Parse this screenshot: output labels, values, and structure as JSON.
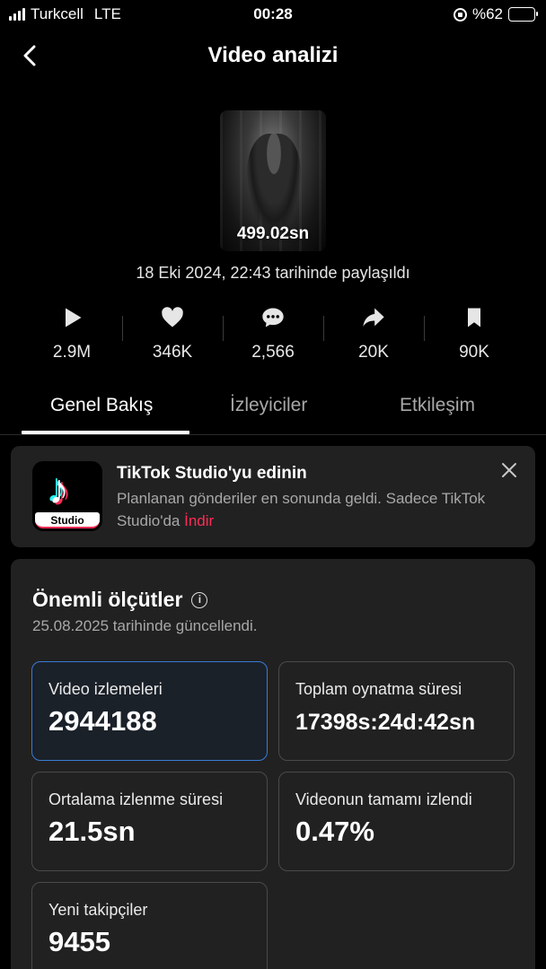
{
  "status_bar": {
    "carrier": "Turkcell",
    "network": "LTE",
    "time": "00:28",
    "battery_text": "%62",
    "battery_level": 0.62,
    "icons": [
      "signal-icon",
      "orientation-lock-icon",
      "battery-charging-icon"
    ]
  },
  "header": {
    "title": "Video analizi",
    "back_icon": "chevron-left-icon"
  },
  "video": {
    "duration": "499.02sn",
    "posted": "18 Eki 2024, 22:43 tarihinde paylaşıldı"
  },
  "stats": [
    {
      "icon": "play-icon",
      "value": "2.9M"
    },
    {
      "icon": "heart-icon",
      "value": "346K"
    },
    {
      "icon": "comment-icon",
      "value": "2,566"
    },
    {
      "icon": "share-icon",
      "value": "20K"
    },
    {
      "icon": "bookmark-icon",
      "value": "90K"
    }
  ],
  "tabs": [
    {
      "label": "Genel Bakış",
      "active": true
    },
    {
      "label": "İzleyiciler",
      "active": false
    },
    {
      "label": "Etkileşim",
      "active": false
    }
  ],
  "promo": {
    "logo_text": "Studio",
    "title": "TikTok Studio'yu edinin",
    "text": "Planlanan gönderiler en sonunda geldi. Sadece TikTok Studio'da",
    "link": "İndir",
    "close_icon": "close-icon"
  },
  "metrics": {
    "title": "Önemli ölçütler",
    "info_icon": "info-icon",
    "updated": "25.08.2025 tarihinde güncellendi.",
    "tiles": [
      {
        "label": "Video izlemeleri",
        "value": "2944188",
        "selected": true
      },
      {
        "label": "Toplam oynatma süresi",
        "value": "17398s:24d:42sn",
        "selected": false
      },
      {
        "label": "Ortalama izlenme süresi",
        "value": "21.5sn",
        "selected": false
      },
      {
        "label": "Videonun tamamı izlendi",
        "value": "0.47%",
        "selected": false
      },
      {
        "label": "Yeni takipçiler",
        "value": "9455",
        "selected": false
      }
    ]
  },
  "colors": {
    "background": "#000000",
    "card": "#212121",
    "accent_red": "#fe2c55",
    "selected_border": "#3a7bd5",
    "battery_green": "#34c759"
  }
}
